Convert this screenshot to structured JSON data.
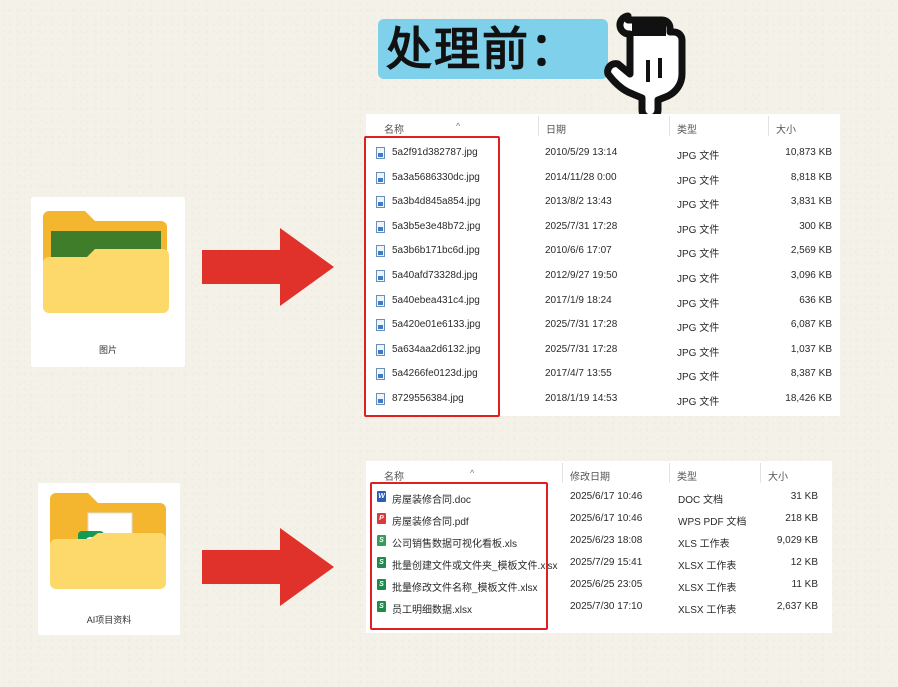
{
  "header": {
    "title": "处理前："
  },
  "folders": [
    {
      "label": "图片"
    },
    {
      "label": "AI项目资料"
    }
  ],
  "panel1": {
    "columns": [
      "名称",
      "日期",
      "类型",
      "大小"
    ],
    "files": [
      {
        "name": "5a2f91d382787.jpg",
        "date": "2010/5/29 13:14",
        "type": "JPG 文件",
        "size": "10,873 KB"
      },
      {
        "name": "5a3a5686330dc.jpg",
        "date": "2014/11/28 0:00",
        "type": "JPG 文件",
        "size": "8,818 KB"
      },
      {
        "name": "5a3b4d845a854.jpg",
        "date": "2013/8/2 13:43",
        "type": "JPG 文件",
        "size": "3,831 KB"
      },
      {
        "name": "5a3b5e3e48b72.jpg",
        "date": "2025/7/31 17:28",
        "type": "JPG 文件",
        "size": "300 KB"
      },
      {
        "name": "5a3b6b171bc6d.jpg",
        "date": "2010/6/6 17:07",
        "type": "JPG 文件",
        "size": "2,569 KB"
      },
      {
        "name": "5a40afd73328d.jpg",
        "date": "2012/9/27 19:50",
        "type": "JPG 文件",
        "size": "3,096 KB"
      },
      {
        "name": "5a40ebea431c4.jpg",
        "date": "2017/1/9 18:24",
        "type": "JPG 文件",
        "size": "636 KB"
      },
      {
        "name": "5a420e01e6133.jpg",
        "date": "2025/7/31 17:28",
        "type": "JPG 文件",
        "size": "6,087 KB"
      },
      {
        "name": "5a634aa2d6132.jpg",
        "date": "2025/7/31 17:28",
        "type": "JPG 文件",
        "size": "1,037 KB"
      },
      {
        "name": "5a4266fe0123d.jpg",
        "date": "2017/4/7 13:55",
        "type": "JPG 文件",
        "size": "8,387 KB"
      },
      {
        "name": "8729556384.jpg",
        "date": "2018/1/19 14:53",
        "type": "JPG 文件",
        "size": "18,426 KB"
      }
    ]
  },
  "panel2": {
    "columns": [
      "名称",
      "修改日期",
      "类型",
      "大小"
    ],
    "files": [
      {
        "name": "房屋装修合同.doc",
        "date": "2025/6/17 10:46",
        "type": "DOC 文档",
        "size": "31 KB",
        "icon": "word-doc-icon",
        "color": "#2b5cb8"
      },
      {
        "name": "房屋装修合同.pdf",
        "date": "2025/6/17 10:46",
        "type": "WPS PDF 文档",
        "size": "218 KB",
        "icon": "pdf-doc-icon",
        "color": "#d93a3a"
      },
      {
        "name": "公司销售数据可视化看板.xls",
        "date": "2025/6/23 18:08",
        "type": "XLS 工作表",
        "size": "9,029 KB",
        "icon": "xls-doc-icon",
        "color": "#3a9a5a"
      },
      {
        "name": "批量创建文件或文件夹_模板文件.xlsx",
        "date": "2025/7/29 15:41",
        "type": "XLSX 工作表",
        "size": "12 KB",
        "icon": "xlsx-doc-icon",
        "color": "#1e8a4c"
      },
      {
        "name": "批量修改文件名称_模板文件.xlsx",
        "date": "2025/6/25 23:05",
        "type": "XLSX 工作表",
        "size": "11 KB",
        "icon": "xlsx-doc-icon",
        "color": "#1e8a4c"
      },
      {
        "name": "员工明细数据.xlsx",
        "date": "2025/7/30 17:10",
        "type": "XLSX 工作表",
        "size": "2,637 KB",
        "icon": "xlsx-doc-icon",
        "color": "#1e8a4c"
      }
    ]
  },
  "colors": {
    "title_bg": "#7fd0ea",
    "arrow_red": "#e0312b",
    "highlight_red": "#e02020",
    "folder_yellow": "#f7c948"
  }
}
